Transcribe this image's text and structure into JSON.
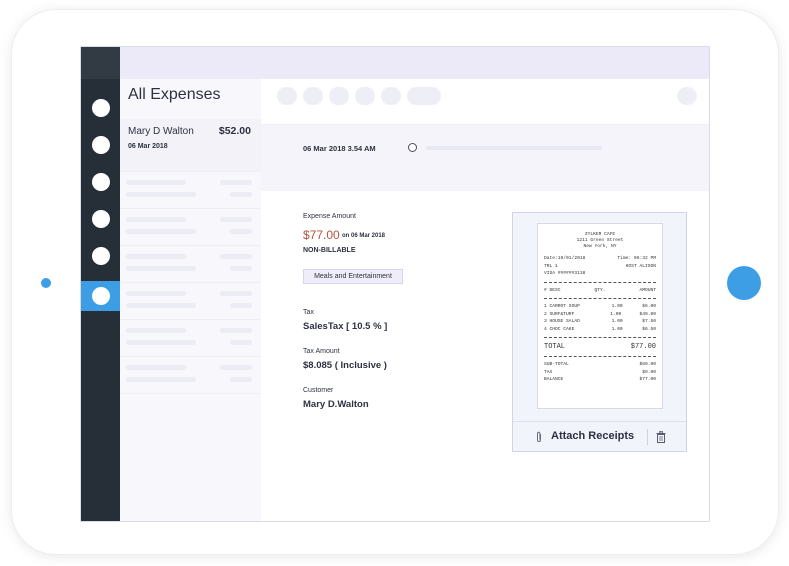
{
  "app": {
    "title": "All Expenses"
  },
  "nav": {
    "items": [
      "nav-item-1",
      "nav-item-2",
      "nav-item-3",
      "nav-item-4",
      "nav-item-5",
      "nav-item-6"
    ],
    "active_index": 5,
    "accent": "#3d9ee6",
    "bg": "#262f37"
  },
  "list": {
    "selected": {
      "name": "Mary D Walton",
      "amount": "$52.00",
      "date": "06 Mar 2018"
    }
  },
  "date_band": {
    "datetime": "06 Mar 2018 3.54 AM"
  },
  "detail": {
    "expense_amount_label": "Expense Amount",
    "amount": "$77.00",
    "on_date": "on 06 Mar 2018",
    "billable": "NON-BILLABLE",
    "category": "Meals and Entertainment",
    "tax_label": "Tax",
    "tax_value": "SalesTax [ 10.5 % ]",
    "tax_amount_label": "Tax Amount",
    "tax_amount_value": "$8.085 ( Inclusive )",
    "customer_label": "Customer",
    "customer_value": "Mary D.Walton",
    "amount_color": "#b4533e"
  },
  "receipt": {
    "store": "ZYLKER CAFE",
    "address1": "1211 Green Street",
    "address2": "New York, NY",
    "date": "Date:19/01/2018",
    "time": "Time: 06:32 PM",
    "trl": "TRL 1",
    "host": "HOST ALISON",
    "visa": "VISA ######3138",
    "header": {
      "desc": "# DESC",
      "qty": "QTY.",
      "amount": "AMOUNT"
    },
    "items": [
      {
        "desc": "1 CARROT SOUP",
        "qty": "1.00",
        "amount": "$6.00"
      },
      {
        "desc": "2 SURF&TURF",
        "qty": "1.00",
        "amount": "$49.00"
      },
      {
        "desc": "3 HOUSE SALAD",
        "qty": "1.00",
        "amount": "$7.50"
      },
      {
        "desc": "4 CHOC CAKE",
        "qty": "1.00",
        "amount": "$6.50"
      }
    ],
    "total_label": "TOTAL",
    "total_value": "$77.00",
    "subtotal_label": "SUB-TOTAL",
    "subtotal_value": "$69.00",
    "tax_label": "TAX",
    "tax_value": "$9.00",
    "balance_label": "BALANCE",
    "balance_value": "$77.00"
  },
  "attach": {
    "label": "Attach Receipts",
    "icon": "paperclip-icon",
    "delete_icon": "trash-icon"
  }
}
